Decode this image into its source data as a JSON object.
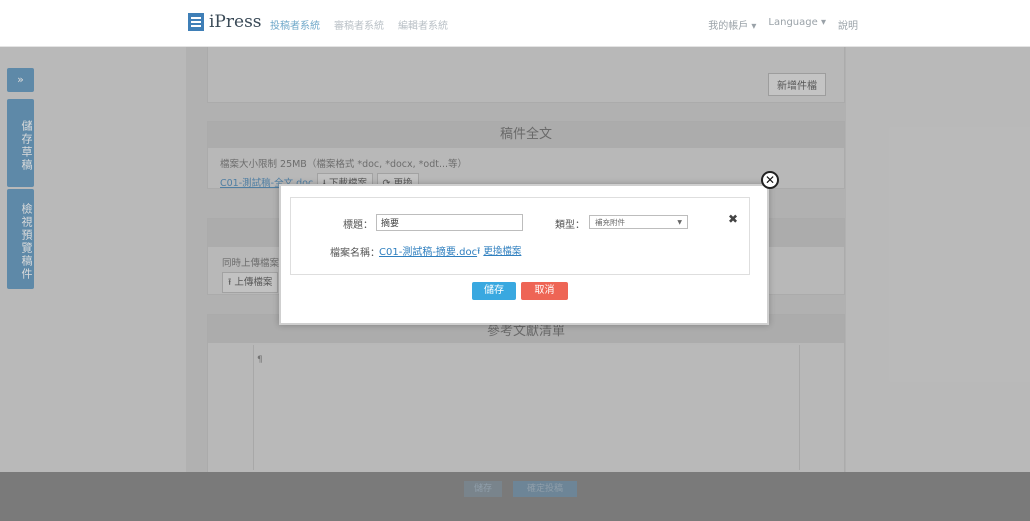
{
  "header": {
    "logo_text": "iPress",
    "nav": [
      "投稿者系統",
      "審稿者系統",
      "編輯者系統"
    ],
    "account": "我的帳戶",
    "language": "Language",
    "help": "說明"
  },
  "sidebar": {
    "tabs": [
      "»",
      "儲存草稿",
      "檢視預覽稿件"
    ]
  },
  "background": {
    "add_attachment_button": "新增件檔",
    "fulltext_title": "稿件全文",
    "file_rule": "檔案大小限制 25MB（檔案格式 *doc, *docx, *odt...等）",
    "file_link": "C01-測試稿-全文.doc",
    "download": "下載檔案",
    "replace": "更換",
    "upload_hint": "同時上傳檔案",
    "upload_button": "上傳檔案",
    "references_title": "參考文獻清單",
    "textarea_marker": "¶",
    "bottom_save": "儲存",
    "bottom_submit": "確定投稿"
  },
  "modal": {
    "title_label": "標題：",
    "title_value": "摘要",
    "type_label": "類型：",
    "type_selected": "補充附件",
    "filename_label": "檔案名稱：",
    "filename_value": "C01-測試稿-摘要.doc",
    "replace_file": "更換檔案",
    "save": "儲存",
    "cancel": "取消"
  },
  "colors": {
    "primary": "#39a8e0",
    "danger": "#ee6555",
    "link": "#2f7fbf"
  }
}
